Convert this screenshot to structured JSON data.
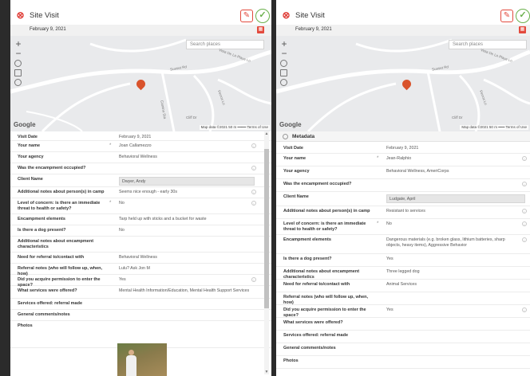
{
  "left": {
    "title": "Site Visit",
    "date_bar": "February 9, 2021",
    "search_placeholder": "Search places",
    "google_logo": "Google",
    "map_credit": "Map data ©2021   50 m ━━━━   Terms of Use",
    "streets": [
      "Vista De La Playa Ln",
      "Sunset Rd",
      "Ferros Ln",
      "Camino Sta",
      "Cliff Dr"
    ],
    "fields": [
      {
        "label": "Visit Date",
        "value": "February 9, 2021"
      },
      {
        "label": "Your name",
        "value": "Joan Callamezzo",
        "required": "*"
      },
      {
        "label": "Your agency",
        "value": "Behavioral Wellness"
      },
      {
        "label": "Was the encampment occupied?",
        "value": ""
      },
      {
        "label": "Client Name",
        "value": "Dwyer, Andy"
      },
      {
        "label": "Additional notes about person(s) in camp",
        "value": "Seems nice enough - early 30s"
      },
      {
        "label": "Level of concern: is there an immediate threat to health or safety?",
        "value": "No",
        "required": "*"
      },
      {
        "label": "Encampment elements",
        "value": "Tarp held up with sticks and a bucket for waste"
      },
      {
        "label": "Is there a dog present?",
        "value": "No"
      },
      {
        "label": "Additional notes about encampment characteristics",
        "value": ""
      },
      {
        "label": "Need for referral to/contact with",
        "value": "Behavioral Wellness"
      },
      {
        "label": "Referral notes (who will follow up, when, how)",
        "value": "Lulu? Ask Jon M"
      },
      {
        "label": "Did you acquire permission to enter the space?",
        "value": "Yes"
      },
      {
        "label": "What services were offered?",
        "value": "Mental Health Information/Education, Mental Health Support Services"
      },
      {
        "label": "Services offered: referral made",
        "value": ""
      },
      {
        "label": "General comments/notes",
        "value": ""
      },
      {
        "label": "Photos",
        "value": ""
      }
    ]
  },
  "right": {
    "title": "Site Visit",
    "date_bar": "February 9, 2021",
    "search_placeholder": "Search places",
    "google_logo": "Google",
    "map_credit": "Map data ©2021   50 m ━━━   Terms of Use",
    "metadata_header": "Metadata",
    "streets": [
      "Vista De La Playa Ln",
      "Sunset Rd",
      "Ferros Ln",
      "Cliff Dr"
    ],
    "fields": [
      {
        "label": "Visit Date",
        "value": "February 9, 2021"
      },
      {
        "label": "Your name",
        "value": "Jean-Ralphio",
        "required": "*"
      },
      {
        "label": "Your agency",
        "value": "Behavioral Wellness, AmeriCorps"
      },
      {
        "label": "Was the encampment occupied?",
        "value": ""
      },
      {
        "label": "Client Name",
        "value": "Ludgate, April"
      },
      {
        "label": "Additional notes about person(s) in camp",
        "value": "Resistant to services"
      },
      {
        "label": "Level of concern: is there an immediate threat to health or safety?",
        "value": "No",
        "required": "*"
      },
      {
        "label": "Encampment elements",
        "value": "Dangerous materials (e.g. broken glass, lithium batteries, sharp objects, heavy items), Aggressive Behavior"
      },
      {
        "label": "Is there a dog present?",
        "value": "Yes"
      },
      {
        "label": "Additional notes about encampment characteristics",
        "value": "Three legged dog"
      },
      {
        "label": "Need for referral to/contact with",
        "value": "Animal Services"
      },
      {
        "label": "Referral notes (who will follow up, when, how)",
        "value": ""
      },
      {
        "label": "Did you acquire permission to enter the space?",
        "value": "Yes"
      },
      {
        "label": "What services were offered?",
        "value": ""
      },
      {
        "label": "Services offered: referral made",
        "value": ""
      },
      {
        "label": "General comments/notes",
        "value": ""
      },
      {
        "label": "Photos",
        "value": ""
      }
    ]
  },
  "colors": {
    "accent_red": "#e34a3d",
    "accent_green": "#6ab04c"
  },
  "icons": {
    "close": "close-circle-icon",
    "edit": "edit-icon",
    "save": "check-circle-icon",
    "calendar": "calendar-icon",
    "info": "info-icon"
  }
}
